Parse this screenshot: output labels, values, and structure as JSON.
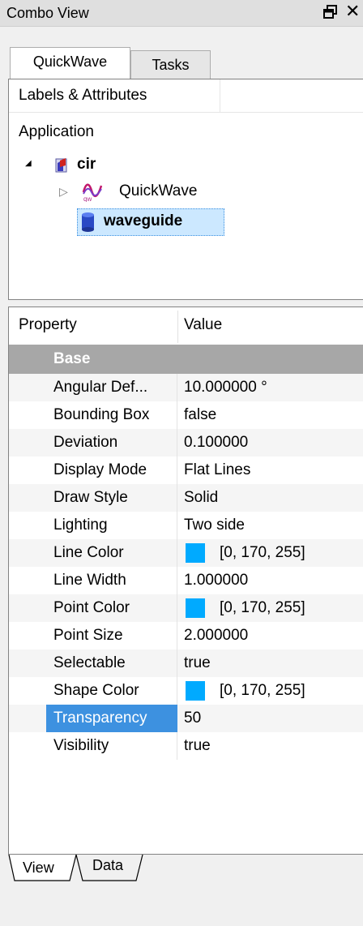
{
  "window": {
    "title": "Combo View",
    "float_icon": "float-window-icon",
    "close_symbol": "✕"
  },
  "tabs": [
    {
      "label": "QuickWave",
      "active": true
    },
    {
      "label": "Tasks",
      "active": false
    }
  ],
  "tree": {
    "header": "Labels & Attributes",
    "root_label": "Application",
    "expanded_arrow": "◢",
    "collapsed_arrow": "▷",
    "nodes": [
      {
        "label": "cir",
        "icon": "document-icon",
        "bold": true
      },
      {
        "label": "QuickWave",
        "icon": "quickwave-icon",
        "bold": false
      },
      {
        "label": "waveguide",
        "icon": "cylinder-icon",
        "bold": true,
        "selected": true
      }
    ]
  },
  "properties": {
    "columns": [
      "Property",
      "Value"
    ],
    "group": "Base",
    "rows": [
      {
        "name": "Angular Def...",
        "value": "10.000000 °"
      },
      {
        "name": "Bounding Box",
        "value": "false"
      },
      {
        "name": "Deviation",
        "value": "0.100000"
      },
      {
        "name": "Display Mode",
        "value": "Flat Lines"
      },
      {
        "name": "Draw Style",
        "value": "Solid"
      },
      {
        "name": "Lighting",
        "value": "Two side"
      },
      {
        "name": "Line Color",
        "value": "[0, 170, 255]",
        "swatch": "#00aaff"
      },
      {
        "name": "Line Width",
        "value": "1.000000"
      },
      {
        "name": "Point Color",
        "value": "[0, 170, 255]",
        "swatch": "#00aaff"
      },
      {
        "name": "Point Size",
        "value": "2.000000"
      },
      {
        "name": "Selectable",
        "value": "true"
      },
      {
        "name": "Shape Color",
        "value": "[0, 170, 255]",
        "swatch": "#00aaff"
      },
      {
        "name": "Transparency",
        "value": "50",
        "selected": true
      },
      {
        "name": "Visibility",
        "value": "true"
      }
    ]
  },
  "bottom_tabs": [
    {
      "label": "View",
      "active": true
    },
    {
      "label": "Data",
      "active": false
    }
  ],
  "colors": {
    "selection": "#3d91e0",
    "group_header": "#a7a7a7",
    "swatch": "#00aaff"
  }
}
